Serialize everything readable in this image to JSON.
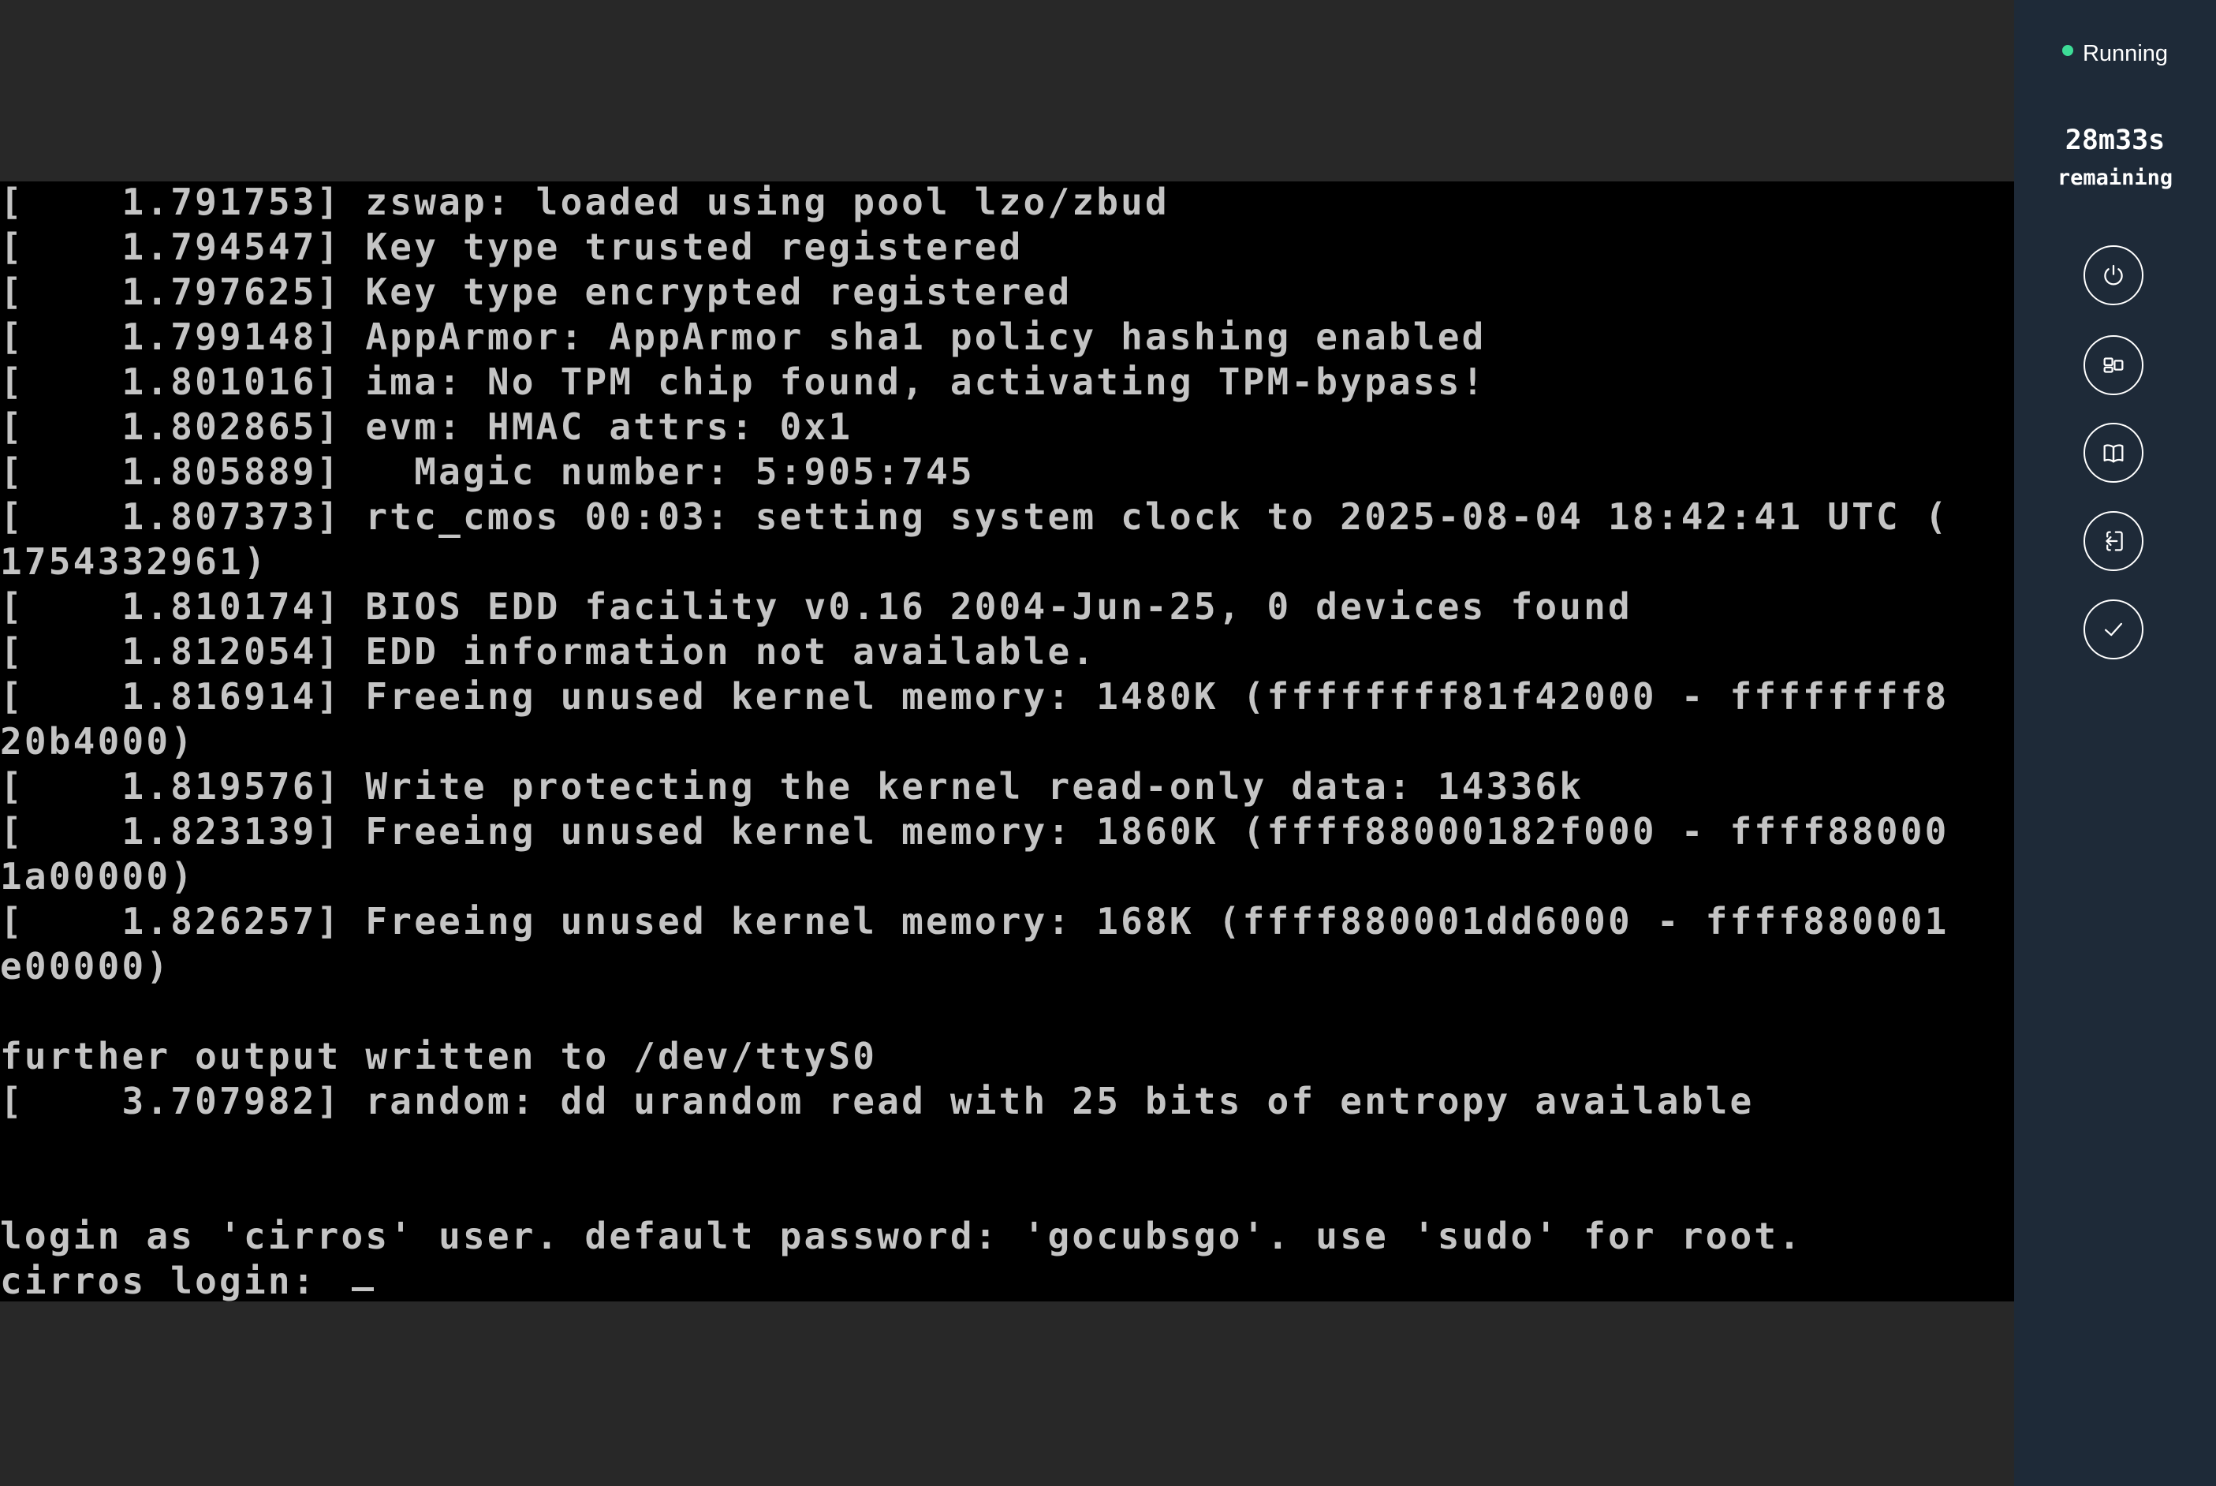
{
  "console": {
    "lines": [
      "[    1.791753] zswap: loaded using pool lzo/zbud",
      "[    1.794547] Key type trusted registered",
      "[    1.797625] Key type encrypted registered",
      "[    1.799148] AppArmor: AppArmor sha1 policy hashing enabled",
      "[    1.801016] ima: No TPM chip found, activating TPM-bypass!",
      "[    1.802865] evm: HMAC attrs: 0x1",
      "[    1.805889]   Magic number: 5:905:745",
      "[    1.807373] rtc_cmos 00:03: setting system clock to 2025-08-04 18:42:41 UTC (",
      "1754332961)",
      "[    1.810174] BIOS EDD facility v0.16 2004-Jun-25, 0 devices found",
      "[    1.812054] EDD information not available.",
      "[    1.816914] Freeing unused kernel memory: 1480K (ffffffff81f42000 - ffffffff8",
      "20b4000)",
      "[    1.819576] Write protecting the kernel read-only data: 14336k",
      "[    1.823139] Freeing unused kernel memory: 1860K (ffff88000182f000 - ffff88000",
      "1a00000)",
      "[    1.826257] Freeing unused kernel memory: 168K (ffff880001dd6000 - ffff880001",
      "e00000)",
      "",
      "further output written to /dev/ttyS0",
      "[    3.707982] random: dd urandom read with 25 bits of entropy available",
      "",
      "",
      "login as 'cirros' user. default password: 'gocubsgo'. use 'sudo' for root.",
      "cirros login: "
    ]
  },
  "sidebar": {
    "status": "Running",
    "status_color": "#3ddc97",
    "timer_value": "28m33s",
    "timer_label": "remaining",
    "controls": [
      {
        "name": "power-icon"
      },
      {
        "name": "layout-icon"
      },
      {
        "name": "book-icon"
      },
      {
        "name": "exit-icon"
      },
      {
        "name": "checkmark-icon"
      }
    ]
  }
}
